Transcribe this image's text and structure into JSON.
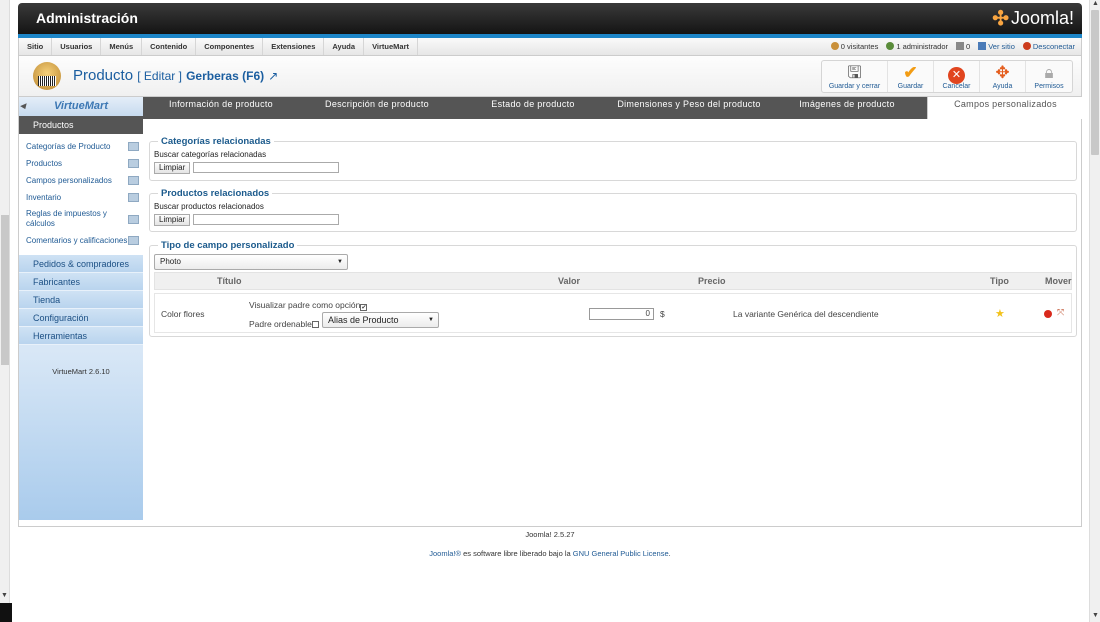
{
  "header": {
    "title": "Administración",
    "logo_text": "Joomla!"
  },
  "menu": {
    "items": [
      "Sitio",
      "Usuarios",
      "Menús",
      "Contenido",
      "Componentes",
      "Extensiones",
      "Ayuda",
      "VirtueMart"
    ],
    "status": {
      "visitors": "0 visitantes",
      "admins": "1 administrador",
      "messages": "0",
      "view_site": "Ver sitio",
      "logout": "Desconectar"
    }
  },
  "toolbar": {
    "title": "Producto",
    "edit_label": "[ Editar ]",
    "product_name": "Gerberas (F6)",
    "buttons": {
      "save_close": "Guardar y cerrar",
      "save": "Guardar",
      "cancel": "Cancelar",
      "help": "Ayuda",
      "permissions": "Permisos"
    }
  },
  "sidebar": {
    "logo_text": "VirtueMart",
    "active_section": "Productos",
    "sub_items": [
      "Categorías de Producto",
      "Productos",
      "Campos personalizados",
      "Inventario",
      "Reglas de impuestos y cálculos",
      "Comentarios y calificaciones"
    ],
    "sections": [
      "Pedidos & compradores",
      "Fabricantes",
      "Tienda",
      "Configuración",
      "Herramientas"
    ],
    "version": "VirtueMart 2.6.10"
  },
  "tabs": [
    "Información de producto",
    "Descripción de producto",
    "Estado de producto",
    "Dimensiones y Peso del producto",
    "Imágenes de producto",
    "Campos personalizados"
  ],
  "related_categories": {
    "legend": "Categorías relacionadas",
    "search_label": "Buscar categorías relacionadas",
    "clear_button": "Limpiar",
    "search_value": ""
  },
  "related_products": {
    "legend": "Productos relacionados",
    "search_label": "Buscar productos relacionados",
    "clear_button": "Limpiar",
    "search_value": ""
  },
  "custom_field_type": {
    "legend": "Tipo de campo personalizado",
    "selected": "Photo",
    "columns": {
      "title": "Título",
      "value": "Valor",
      "price": "Precio",
      "type": "Tipo",
      "move": "Mover"
    },
    "row": {
      "title": "Color flores",
      "show_parent_label": "Visualizar padre como opción",
      "show_parent_checked": true,
      "parent_orderable_label": "Padre ordenable",
      "parent_orderable_checked": false,
      "alias_select": "Alias de Producto",
      "price": "0",
      "currency": "$",
      "description": "La variante Genérica del descendiente"
    }
  },
  "footer": {
    "version": "Joomla! 2.5.27",
    "license_prefix": "Joomla!®",
    "license_middle": " es software libre liberado bajo la ",
    "license_link": "GNU General Public License",
    "license_suffix": "."
  }
}
